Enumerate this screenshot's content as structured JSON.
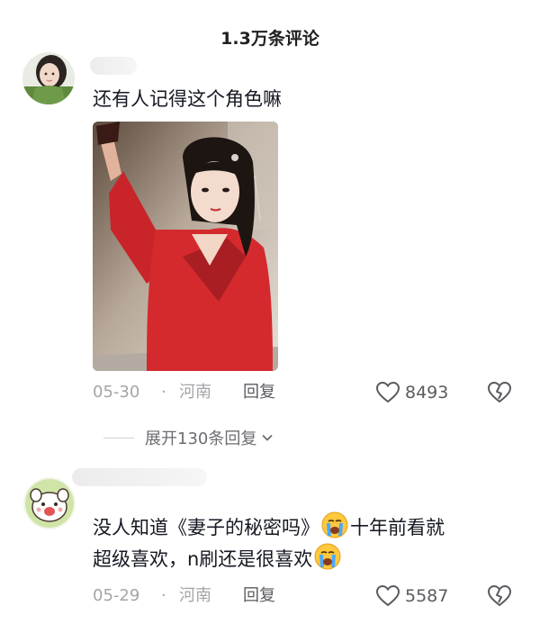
{
  "header": {
    "title": "1.3万条评论"
  },
  "comments": [
    {
      "text": "还有人记得这个角色嘛",
      "date": "05-30",
      "region": "河南",
      "reply_label": "回复",
      "likes": "8493"
    },
    {
      "text_part1": "没人知道《妻子的秘密吗》",
      "text_part2": "十年前看就",
      "text_line2": "超级喜欢，n刷还是很喜欢",
      "date": "05-29",
      "region": "河南",
      "reply_label": "回复",
      "likes": "5587"
    }
  ],
  "expand": {
    "label": "展开130条回复"
  },
  "separator": "·",
  "icons": {
    "emoji": "loudly-crying-face-icon",
    "like": "heart-outline-icon",
    "dislike": "broken-heart-outline-icon",
    "expand": "chevron-down-icon"
  },
  "colors": {
    "meta": "#a4a5a9",
    "text": "#161823",
    "dress": "#d42a2e"
  }
}
